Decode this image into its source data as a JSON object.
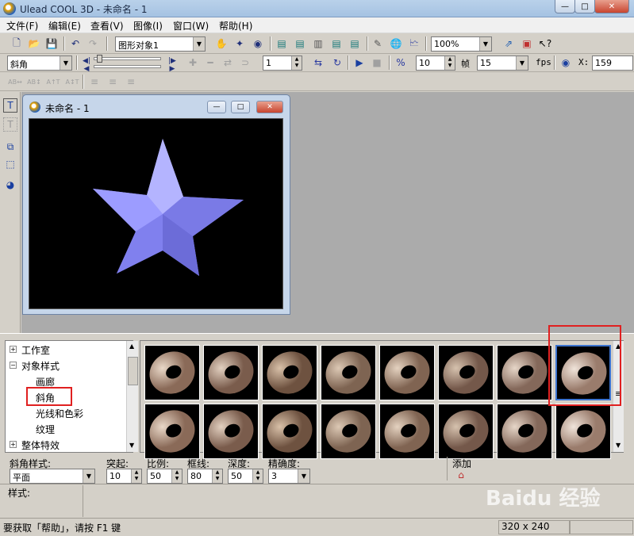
{
  "window": {
    "title": "Ulead COOL 3D - 未命名 - 1",
    "min_glyph": "—",
    "max_glyph": "□",
    "close_glyph": "✕"
  },
  "menu": [
    "文件(F)",
    "编辑(E)",
    "查看(V)",
    "图像(I)",
    "窗口(W)",
    "帮助(H)"
  ],
  "toolbar1": {
    "object_combo": "图形对象1",
    "zoom_combo": "100%"
  },
  "toolbar2": {
    "bevel_combo": "斜角",
    "frame_value": "1",
    "speed_value": "10",
    "frames_label": "帧",
    "frames_value": "15",
    "fps_label": "fps",
    "x_label": "X:",
    "x_value": "159"
  },
  "toolbar3": {
    "text_icons": [
      "AB↔",
      "AB↕",
      "A↑T",
      "A↕T"
    ]
  },
  "document": {
    "title": "未命名 - 1",
    "star_color": "#8c8cff"
  },
  "tree": {
    "items": [
      {
        "label": "工作室",
        "expander": "+"
      },
      {
        "label": "对象样式",
        "expander": "−"
      },
      {
        "label": "画廊",
        "expander": ""
      },
      {
        "label": "斜角",
        "expander": ""
      },
      {
        "label": "光线和色彩",
        "expander": ""
      },
      {
        "label": "纹理",
        "expander": ""
      },
      {
        "label": "整体特效",
        "expander": "+"
      }
    ]
  },
  "gallery": {
    "scroll_up": "▲",
    "scroll_down": "▼",
    "scroll_grip": "≡",
    "selected_index": 7
  },
  "properties": {
    "bevel_style_label": "斜角样式:",
    "bevel_style_value": "平面",
    "protrusion_label": "突起:",
    "protrusion_value": "10",
    "scale_label": "比例:",
    "scale_value": "50",
    "border_label": "框线:",
    "border_value": "80",
    "depth_label": "深度:",
    "depth_value": "50",
    "precision_label": "精确度:",
    "precision_value": "3",
    "add_label": "添加"
  },
  "style_label": "样式:",
  "status": {
    "help_text": "要获取「帮助」，请按 F1 键",
    "size_text": "320 x 240"
  },
  "watermark": "Baidu 经验"
}
